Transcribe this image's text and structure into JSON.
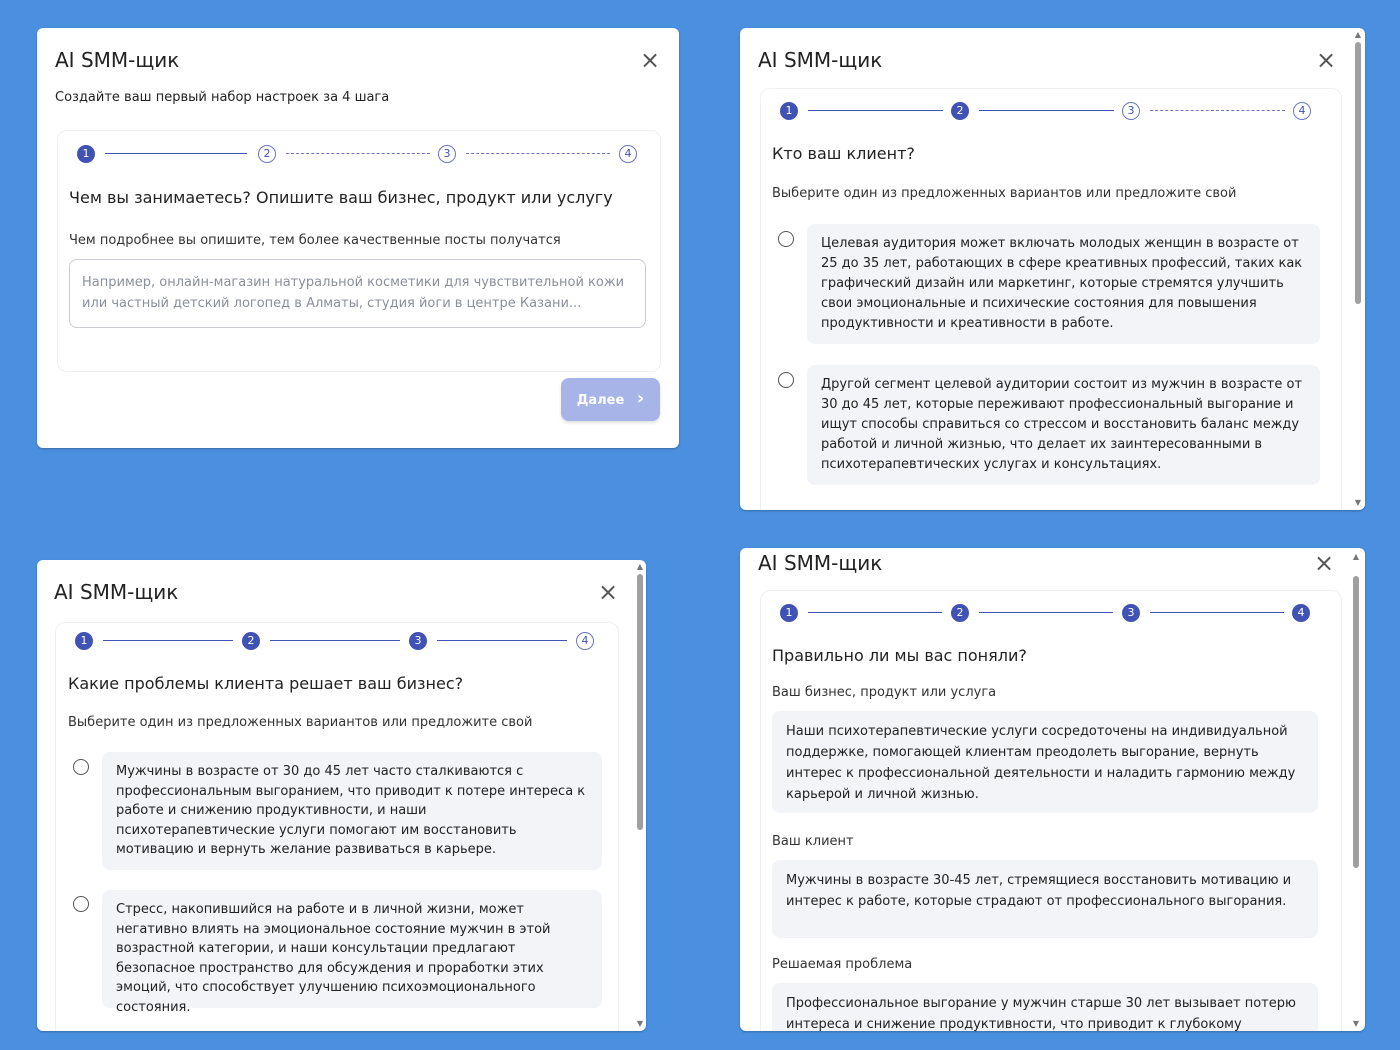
{
  "app_title": "AI SMM-щик",
  "close_glyph": "×",
  "steps": [
    "1",
    "2",
    "3",
    "4"
  ],
  "panel1": {
    "subtitle": "Создайте ваш первый набор настроек за 4 шага",
    "question": "Чем вы занимаетесь? Опишите ваш бизнес, продукт или услугу",
    "hint": "Чем подробнее вы опишите, тем более качественные посты получатся",
    "placeholder": "Например, онлайн-магазин натуральной косметики для чувствительной кожи или частный детский логопед в Алматы, студия йоги в центре Казани...",
    "next_label": "Далее",
    "next_icon": "chevron-right-icon",
    "next_glyph": "›"
  },
  "panel2": {
    "question": "Кто ваш клиент?",
    "hint": "Выберите один из предложенных вариантов или предложите свой",
    "options": [
      "Целевая аудитория может включать молодых женщин в возрасте от 25 до 35 лет, работающих в сфере креативных профессий, таких как графический дизайн или маркетинг, которые стремятся улучшить свои эмоциональные и психические состояния для повышения продуктивности и креативности в работе.",
      "Другой сегмент целевой аудитории состоит из мужчин в возрасте от 30 до 45 лет, которые переживают профессиональный выгорание и ищут способы справиться со стрессом и восстановить баланс между работой и личной жизнью, что делает их заинтересованными в психотерапевтических услугах и консультациях."
    ]
  },
  "panel3": {
    "question": "Какие проблемы клиента решает ваш бизнес?",
    "hint": "Выберите один из предложенных вариантов или предложите свой",
    "options": [
      "Мужчины в возрасте от 30 до 45 лет часто сталкиваются с профессиональным выгоранием, что приводит к потере интереса к работе и снижению продуктивности, и наши психотерапевтические услуги помогают им восстановить мотивацию и вернуть желание развиваться в карьере.",
      "Стресс, накопившийся на работе и в личной жизни, может негативно влиять на эмоциональное состояние мужчин в этой возрастной категории, и наши консультации предлагают безопасное пространство для обсуждения и проработки этих эмоций, что способствует улучшению психоэмоционального состояния."
    ]
  },
  "panel4": {
    "question": "Правильно ли мы вас поняли?",
    "business_label": "Ваш бизнес, продукт или услуга",
    "business_text": "Наши психотерапевтические услуги сосредоточены на индивидуальной поддержке, помогающей клиентам преодолеть выгорание, вернуть интерес к профессиональной деятельности и наладить гармонию между карьерой и личной жизнью.",
    "client_label": "Ваш клиент",
    "client_text": "Мужчины в возрасте 30-45 лет, стремящиеся восстановить мотивацию и интерес к работе, которые страдают от профессионального выгорания.",
    "problem_label": "Решаемая проблема",
    "problem_text": "Профессиональное выгорание у мужчин старше 30 лет вызывает потерю интереса и снижение продуктивности, что приводит к глубокому"
  },
  "colors": {
    "background": "#4a8fe0",
    "accent": "#4053b5",
    "button_disabled": "#a6b4e8",
    "card": "#f2f4f8"
  }
}
